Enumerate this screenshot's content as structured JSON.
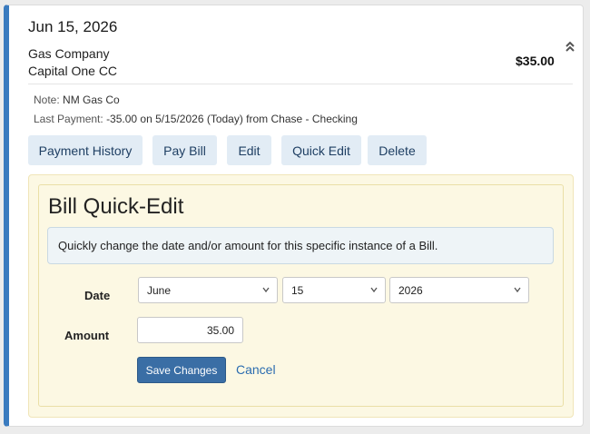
{
  "bill": {
    "date": "Jun 15, 2026",
    "payee_line1": "Gas Company",
    "payee_line2": "Capital One CC",
    "amount": "$35.00",
    "note_label": "Note:",
    "note_value": "NM Gas Co",
    "last_payment_label": "Last Payment:",
    "last_payment_value": "-35.00 on 5/15/2026 (Today) from Chase - Checking"
  },
  "actions": {
    "payment_history": "Payment History",
    "pay_bill": "Pay Bill",
    "edit": "Edit",
    "quick_edit": "Quick Edit",
    "delete": "Delete"
  },
  "quick_edit": {
    "title": "Bill Quick-Edit",
    "description": "Quickly change the date and/or amount for this specific instance of a Bill.",
    "date_label": "Date",
    "month": "June",
    "day": "15",
    "year": "2026",
    "amount_label": "Amount",
    "amount_value": "35.00",
    "save_label": "Save Changes",
    "cancel_label": "Cancel"
  },
  "icons": {
    "collapse": "chevron-double-up-icon",
    "select": "chevron-down-icon"
  },
  "colors": {
    "accent_border": "#3a7bbf",
    "button_bg": "#e2ecf5",
    "panel_bg": "#fcf8e3",
    "primary_button": "#3a6ea5",
    "link": "#2b6cb0"
  }
}
